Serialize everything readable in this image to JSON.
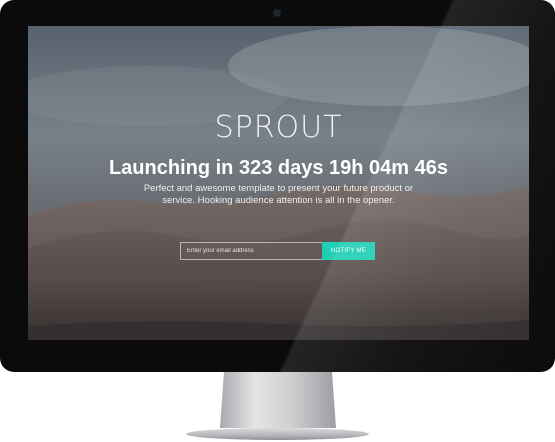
{
  "page": {
    "logo_text": "SPROUT",
    "headline": "Launching in 323 days 19h 04m 46s",
    "subtext": "Perfect and awesome template to present your future product or service. Hooking audience attention is all in the opener."
  },
  "signup": {
    "email_placeholder": "Enter your email address",
    "notify_label": "NOTIFY ME"
  },
  "colors": {
    "accent": "#1fcfb3",
    "bezel": "#0b0b0c",
    "text": "#ffffff"
  },
  "icons": {
    "camera": "webcam-icon"
  }
}
